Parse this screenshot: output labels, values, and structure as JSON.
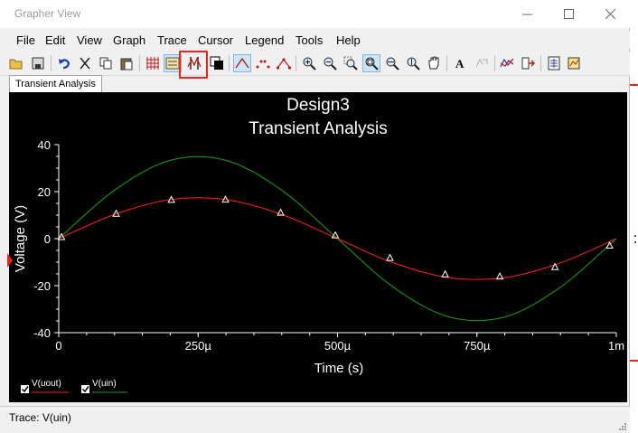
{
  "window": {
    "title": "Grapher View"
  },
  "menu": [
    "File",
    "Edit",
    "View",
    "Graph",
    "Trace",
    "Cursor",
    "Legend",
    "Tools",
    "Help"
  ],
  "toolbar": {
    "buttons": [
      {
        "name": "open-icon"
      },
      {
        "name": "save-icon"
      },
      {
        "name": "undo-icon"
      },
      {
        "name": "cut-icon"
      },
      {
        "name": "copy-icon"
      },
      {
        "name": "paste-icon"
      },
      {
        "name": "grid-icon"
      },
      {
        "name": "legend-toggle-icon"
      },
      {
        "name": "cursors-icon"
      },
      {
        "name": "reverse-colors-icon"
      },
      {
        "name": "lines-icon"
      },
      {
        "name": "points-icon"
      },
      {
        "name": "lines-points-icon"
      },
      {
        "name": "zoom-in-icon"
      },
      {
        "name": "zoom-out-icon"
      },
      {
        "name": "zoom-area-icon"
      },
      {
        "name": "zoom-full-icon"
      },
      {
        "name": "zoom-x-icon"
      },
      {
        "name": "zoom-y-icon"
      },
      {
        "name": "pan-hand-icon"
      },
      {
        "name": "add-text-icon"
      },
      {
        "name": "export-icon"
      },
      {
        "name": "overlay-traces-icon"
      },
      {
        "name": "exclude-traces-icon"
      },
      {
        "name": "page-properties-icon"
      },
      {
        "name": "graph-properties-icon"
      }
    ]
  },
  "tab": {
    "label": "Transient Analysis"
  },
  "status": {
    "text": "Trace: V(uin)"
  },
  "colors": {
    "uout": "#ff2020",
    "uin": "#1aa01a",
    "background": "#000000",
    "highlight": "#e8261c"
  },
  "chart_data": {
    "type": "line",
    "title": "Design3",
    "subtitle": "Transient Analysis",
    "xlabel": "Time (s)",
    "ylabel": "Voltage (V)",
    "xlim": [
      0,
      0.001
    ],
    "ylim": [
      -40,
      40
    ],
    "x_ticks": [
      {
        "value": 0,
        "label": "0"
      },
      {
        "value": 0.00025,
        "label": "250µ"
      },
      {
        "value": 0.0005,
        "label": "500µ"
      },
      {
        "value": 0.00075,
        "label": "750µ"
      },
      {
        "value": 0.001,
        "label": "1m"
      }
    ],
    "y_ticks": [
      {
        "value": 40,
        "label": "40"
      },
      {
        "value": 20,
        "label": "20"
      },
      {
        "value": 0,
        "label": "0"
      },
      {
        "value": -20,
        "label": "-20"
      },
      {
        "value": -40,
        "label": "-40"
      }
    ],
    "series": [
      {
        "name": "V(uout)",
        "color": "#ff2020",
        "x": [
          0,
          0.0001,
          0.0002,
          0.0003,
          0.0004,
          0.0005,
          0.0006,
          0.0007,
          0.0008,
          0.0009,
          0.001
        ],
        "y": [
          0,
          10.3,
          16.6,
          16.6,
          10.3,
          0,
          -10.3,
          -16.6,
          -16.6,
          -10.3,
          0
        ],
        "markers_x": [
          5e-06,
          0.000103,
          0.000202,
          0.000299,
          0.000398,
          0.000496,
          0.000594,
          0.000693,
          0.000791,
          0.00089,
          0.000988
        ],
        "markers_y": [
          0.6,
          10.5,
          16.4,
          16.5,
          10.9,
          1.3,
          -8.3,
          -15.3,
          -16.2,
          -12.2,
          -3.1
        ]
      },
      {
        "name": "V(uin)",
        "color": "#1aa01a",
        "x": [
          0,
          0.0001,
          0.0002,
          0.0003,
          0.0004,
          0.0005,
          0.0006,
          0.0007,
          0.0008,
          0.0009,
          0.001
        ],
        "y": [
          0,
          20.6,
          33.3,
          33.3,
          20.6,
          0,
          -20.6,
          -33.3,
          -33.3,
          -20.6,
          0
        ]
      }
    ],
    "legend": {
      "placement": "bottom-left",
      "entries": [
        {
          "label": "V(uout)",
          "checked": true
        },
        {
          "label": "V(uin)",
          "checked": true
        }
      ]
    }
  }
}
